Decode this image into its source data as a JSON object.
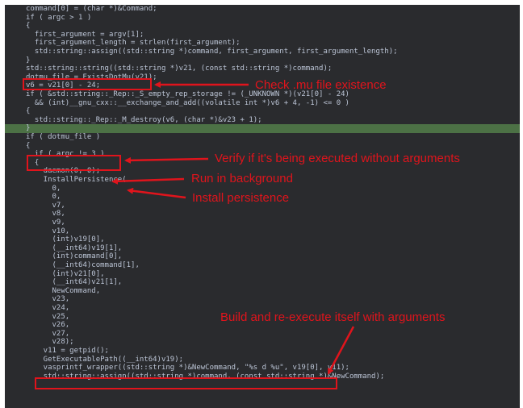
{
  "colors": {
    "background": "#2a2b2e",
    "text": "#bcc5d6",
    "keyword": "#5fa8ff",
    "string": "#c8c8c8",
    "highlight_row": "#4c7145",
    "annotation": "#e0141c"
  },
  "code_lines": [
    "command[0] = (char *)&Command;",
    "if ( argc > 1 )",
    "{",
    "  first_argument = argv[1];",
    "  first_argument_length = strlen(first_argument);",
    "  std::string::assign((std::string *)command, first_argument, first_argument_length);",
    "}",
    "std::string::string((std::string *)v21, (const std::string *)command);",
    "dotmu_file = ExistsDotMu(v21);",
    "v6 = v21[0] - 24;",
    "if ( &std::string::_Rep::_S_empty_rep_storage != (_UNKNOWN *)(v21[0] - 24)",
    "  && (int)__gnu_cxx::__exchange_and_add((volatile int *)v6 + 4, -1) <= 0 )",
    "{",
    "  std::string::_Rep::_M_destroy(v6, (char *)&v23 + 1);",
    "}",
    "if ( dotmu_file )",
    "{",
    "  if ( argc != 3 )",
    "  {",
    "    daemon(0, 0);",
    "    InstallPersistence(",
    "      0,",
    "      0,",
    "      v7,",
    "      v8,",
    "      v9,",
    "      v10,",
    "      (int)v19[0],",
    "      (__int64)v19[1],",
    "      (int)command[0],",
    "      (__int64)command[1],",
    "      (int)v21[0],",
    "      (__int64)v21[1],",
    "      NewCommand,",
    "      v23,",
    "      v24,",
    "      v25,",
    "      v26,",
    "      v27,",
    "      v28);",
    "    v11 = getpid();",
    "    GetExecutablePath((__int64)v19);",
    "    vasprintf_wrapper((std::string *)&NewCommand, \"%s d %u\", v19[0], v11);",
    "    std::string::assign((std::string *)command, (const std::string *)&NewCommand);"
  ],
  "annotations": {
    "check_mu": "Check .mu file existence",
    "verify_args": "Verify if it's being executed without arguments",
    "run_background": "Run in background",
    "install_persistence": "Install persistence",
    "build_reexecute": "Build and re-execute itself with arguments"
  }
}
